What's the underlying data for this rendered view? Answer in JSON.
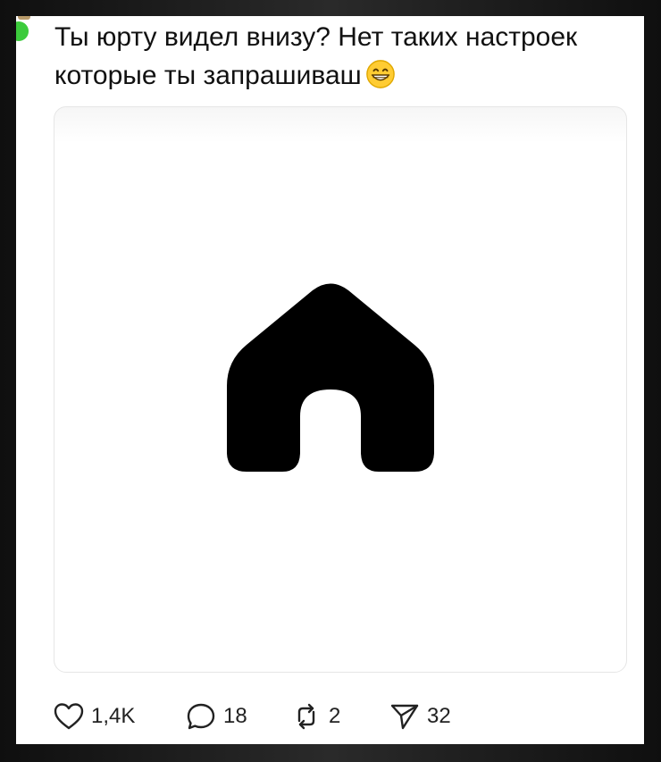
{
  "post": {
    "text": "Ты юрту видел внизу? Нет таких настроек которые ты запрашиваш",
    "emoji": "grinning-face-with-smiling-eyes",
    "media_icon": "home-icon"
  },
  "actions": {
    "likes": "1,4K",
    "replies": "18",
    "reposts": "2",
    "shares": "32"
  },
  "colors": {
    "online": "#3ccb3c",
    "text": "#111111",
    "icon": "#000000"
  }
}
